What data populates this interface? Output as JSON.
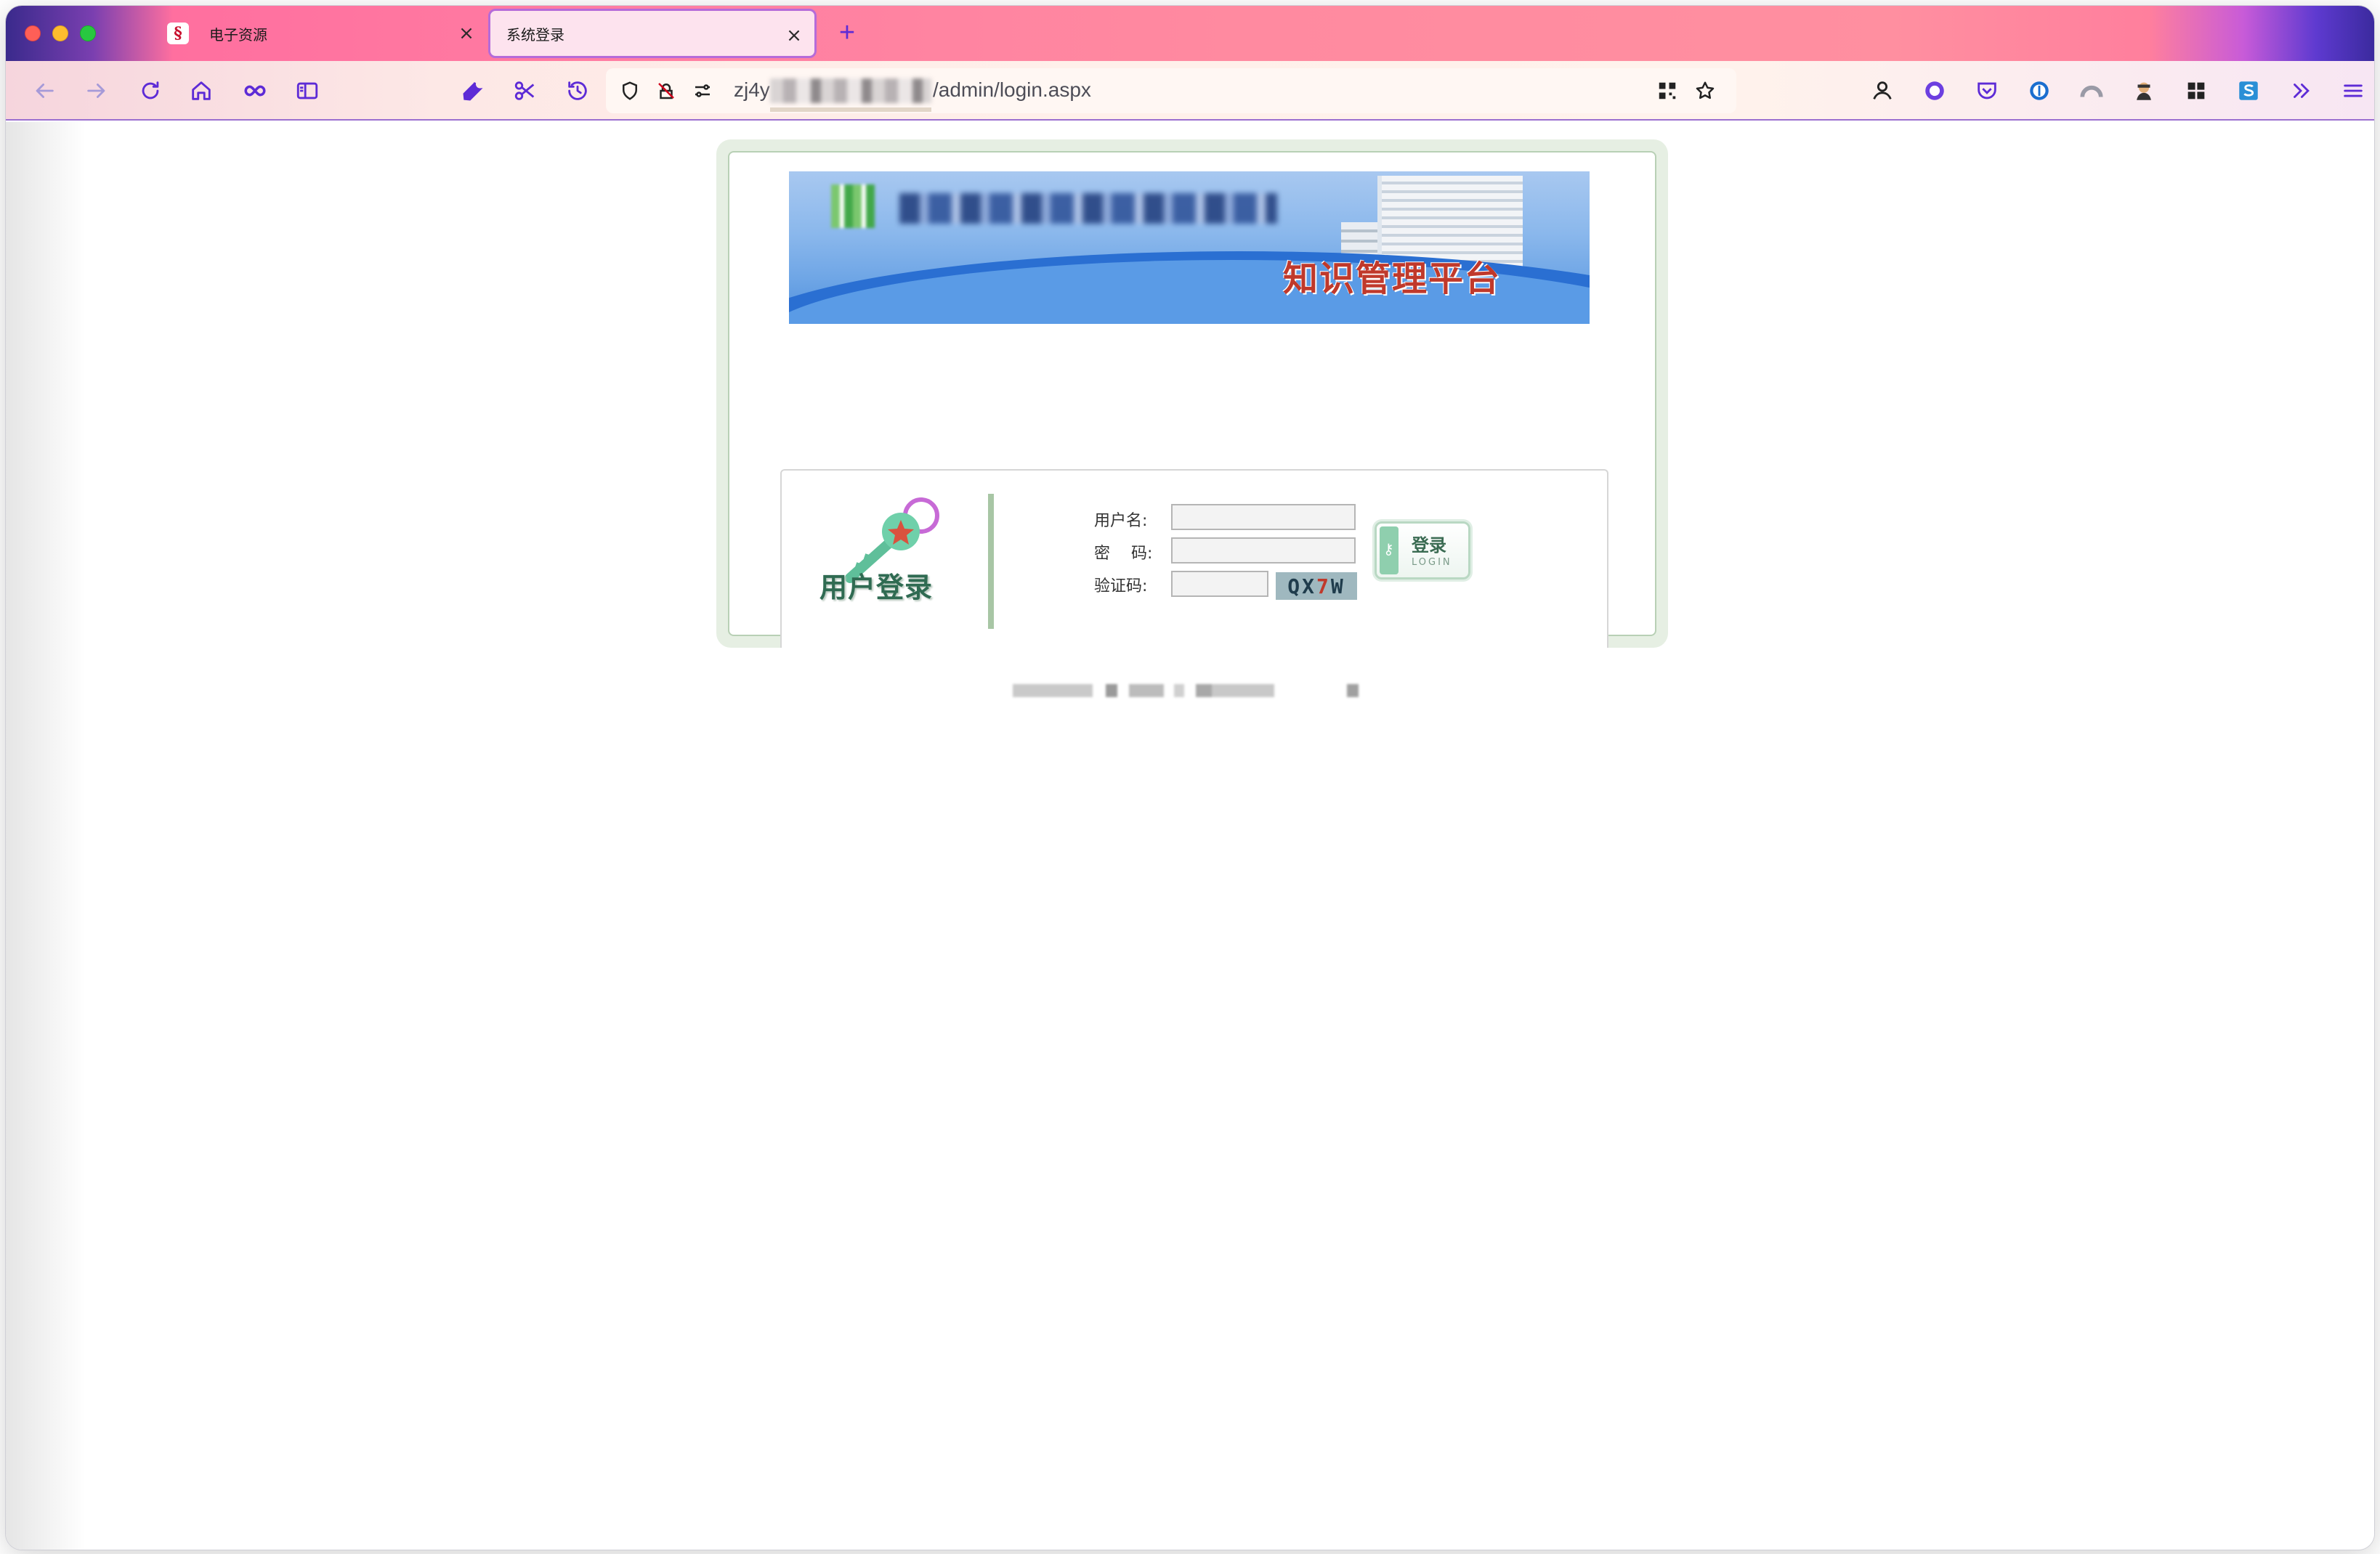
{
  "browser": {
    "tabs": [
      {
        "title": "电子资源",
        "favicon": "red-shield-icon",
        "active": false
      },
      {
        "title": "系统登录",
        "favicon": "none",
        "active": true
      }
    ],
    "new_tab_icon": "plus-icon",
    "close_icon": "close-icon",
    "url": {
      "prefix": "zj4y",
      "suffix": "/admin/login.aspx"
    },
    "toolbar_icons": [
      "back-icon",
      "forward-icon",
      "reload-icon",
      "home-icon",
      "infinity-icon",
      "sidebar-icon",
      "wrench-icon",
      "scissors-icon",
      "history-icon"
    ],
    "url_icons": [
      "shield-icon",
      "no-camera-icon",
      "permissions-icon",
      "qr-icon",
      "bookmark-star-icon"
    ],
    "extension_icons": [
      "account-icon",
      "circle-extension-icon",
      "pocket-icon",
      "password-manager-icon",
      "arc-extension-icon",
      "spy-extension-icon",
      "grid-extension-icon",
      "s-extension-icon",
      "overflow-chevron-icon",
      "menu-icon"
    ],
    "accent_color": "#5d2bd6"
  },
  "page": {
    "banner": {
      "title": "知识管理平台"
    },
    "login_panel": {
      "heading": "用户登录",
      "username_label": "用户名:",
      "password_label": "密　 码:",
      "captcha_label": "验证码:",
      "username_value": "",
      "password_value": "",
      "captcha_value": "",
      "captcha_text_a": "QX",
      "captcha_text_b": "7",
      "captcha_text_c": "W",
      "login_button_cn": "登录",
      "login_button_en": "LOGIN"
    },
    "colors": {
      "panel_border": "#b8d0b5",
      "panel_bg": "#e6efe3",
      "banner_blue": "#4e8fdc",
      "title_red": "#c0392b"
    }
  }
}
